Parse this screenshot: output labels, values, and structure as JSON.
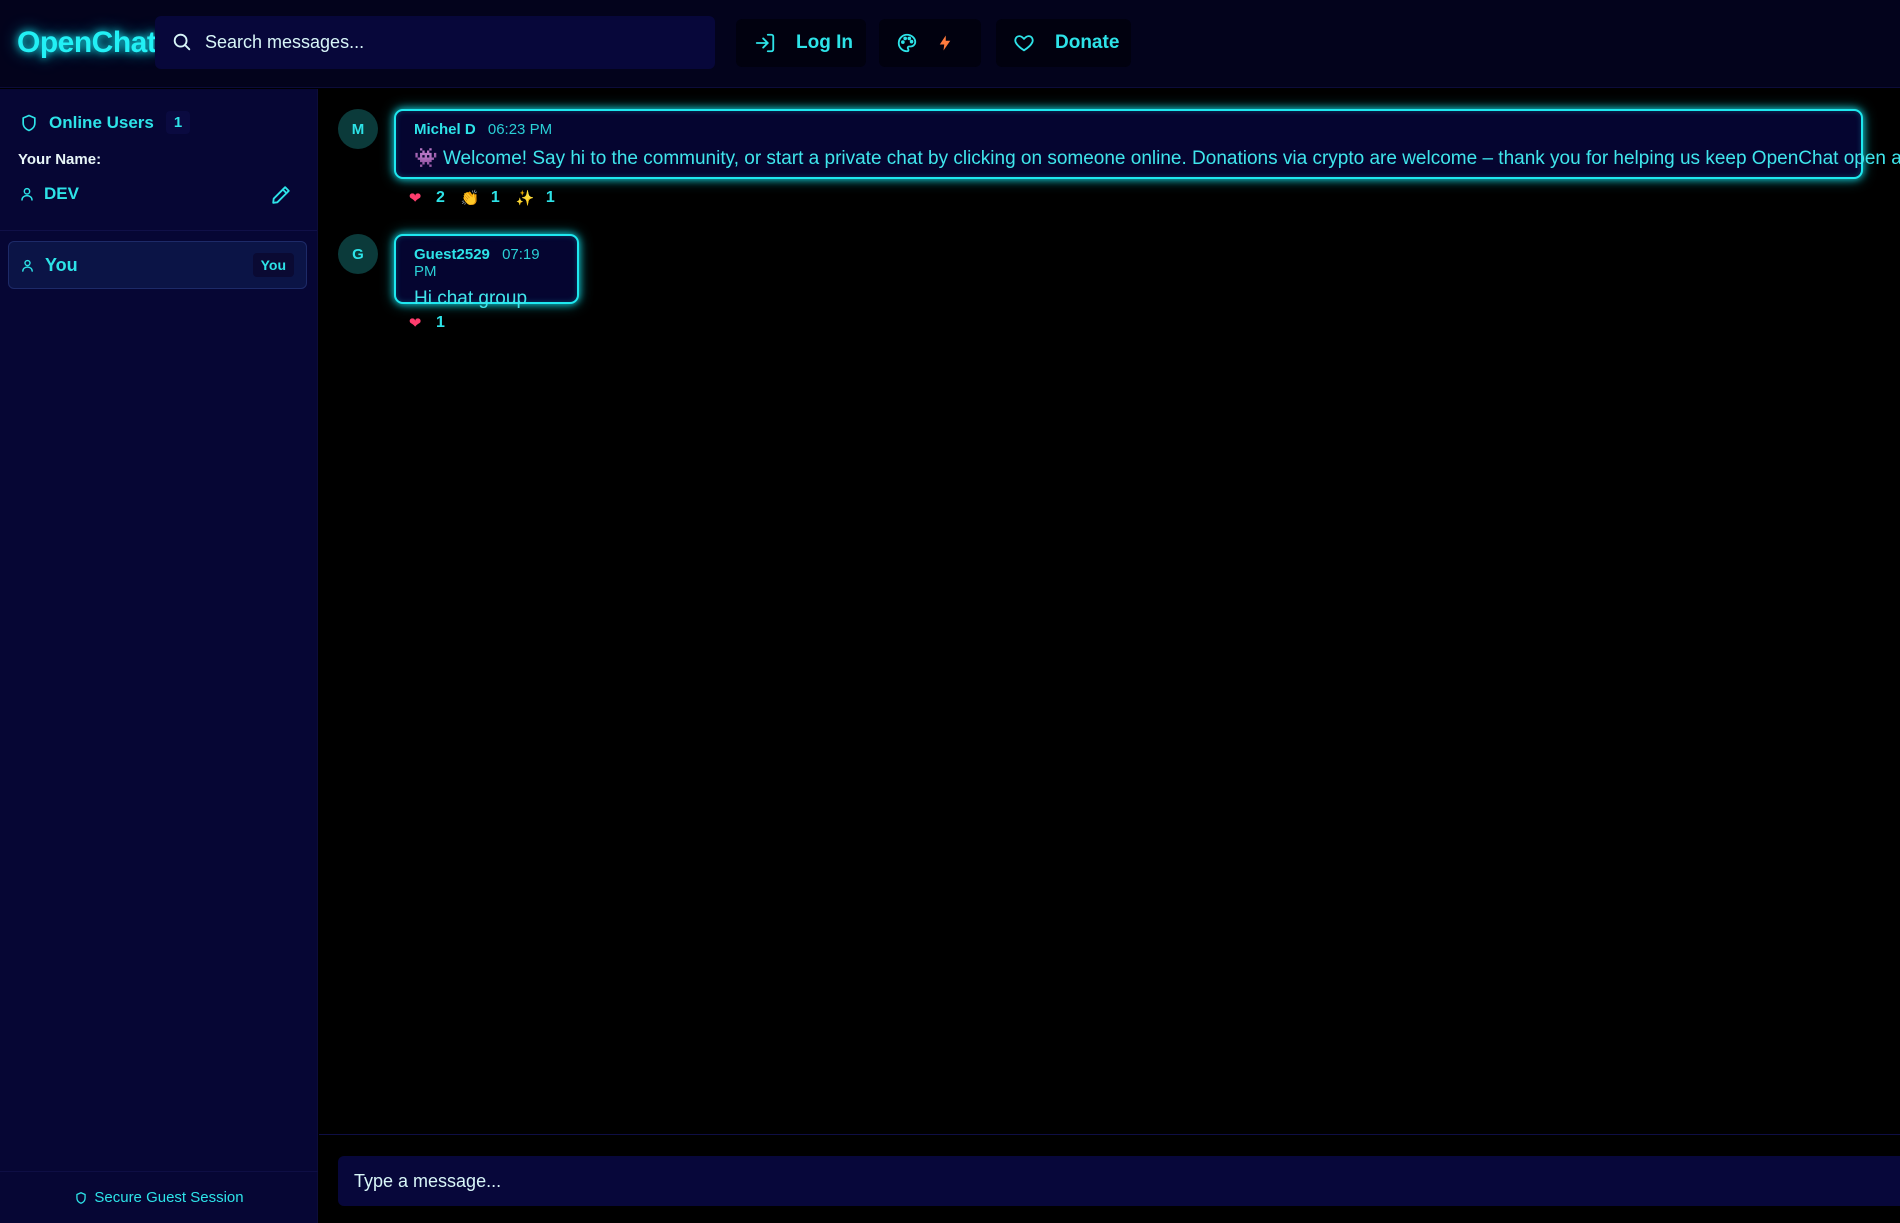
{
  "app": {
    "name": "OpenChat"
  },
  "colors": {
    "accent": "#2de3e8",
    "background": "#000000",
    "panel": "#060634",
    "heart": "#ff3d6e"
  },
  "header": {
    "search": {
      "placeholder": "Search messages...",
      "icon": "search-icon"
    },
    "login_label": "Log In",
    "theme_icons": [
      "palette-icon",
      "bolt-icon"
    ],
    "donate_label": "Donate"
  },
  "sidebar": {
    "online_label": "Online Users",
    "online_count": "1",
    "your_name_label": "Your Name:",
    "current_name": "DEV",
    "users": [
      {
        "label": "You",
        "badge": "You"
      }
    ],
    "footer": "Secure Guest Session"
  },
  "messages": [
    {
      "avatar": "M",
      "author": "Michel D",
      "time": "06:23 PM",
      "emoji": "👾",
      "text": "Welcome! Say hi to the community, or start a private chat by clicking on someone online. Donations via crypto are welcome – thank you for helping us keep OpenChat open and free!",
      "reactions": [
        {
          "emoji": "❤",
          "count": "2"
        },
        {
          "emoji": "👏",
          "count": "1"
        },
        {
          "emoji": "✨",
          "count": "1"
        }
      ]
    },
    {
      "avatar": "G",
      "author": "Guest2529",
      "time": "07:19 PM",
      "text": "Hi chat group",
      "reactions": [
        {
          "emoji": "❤",
          "count": "1"
        }
      ]
    }
  ],
  "composer": {
    "placeholder": "Type a message..."
  }
}
